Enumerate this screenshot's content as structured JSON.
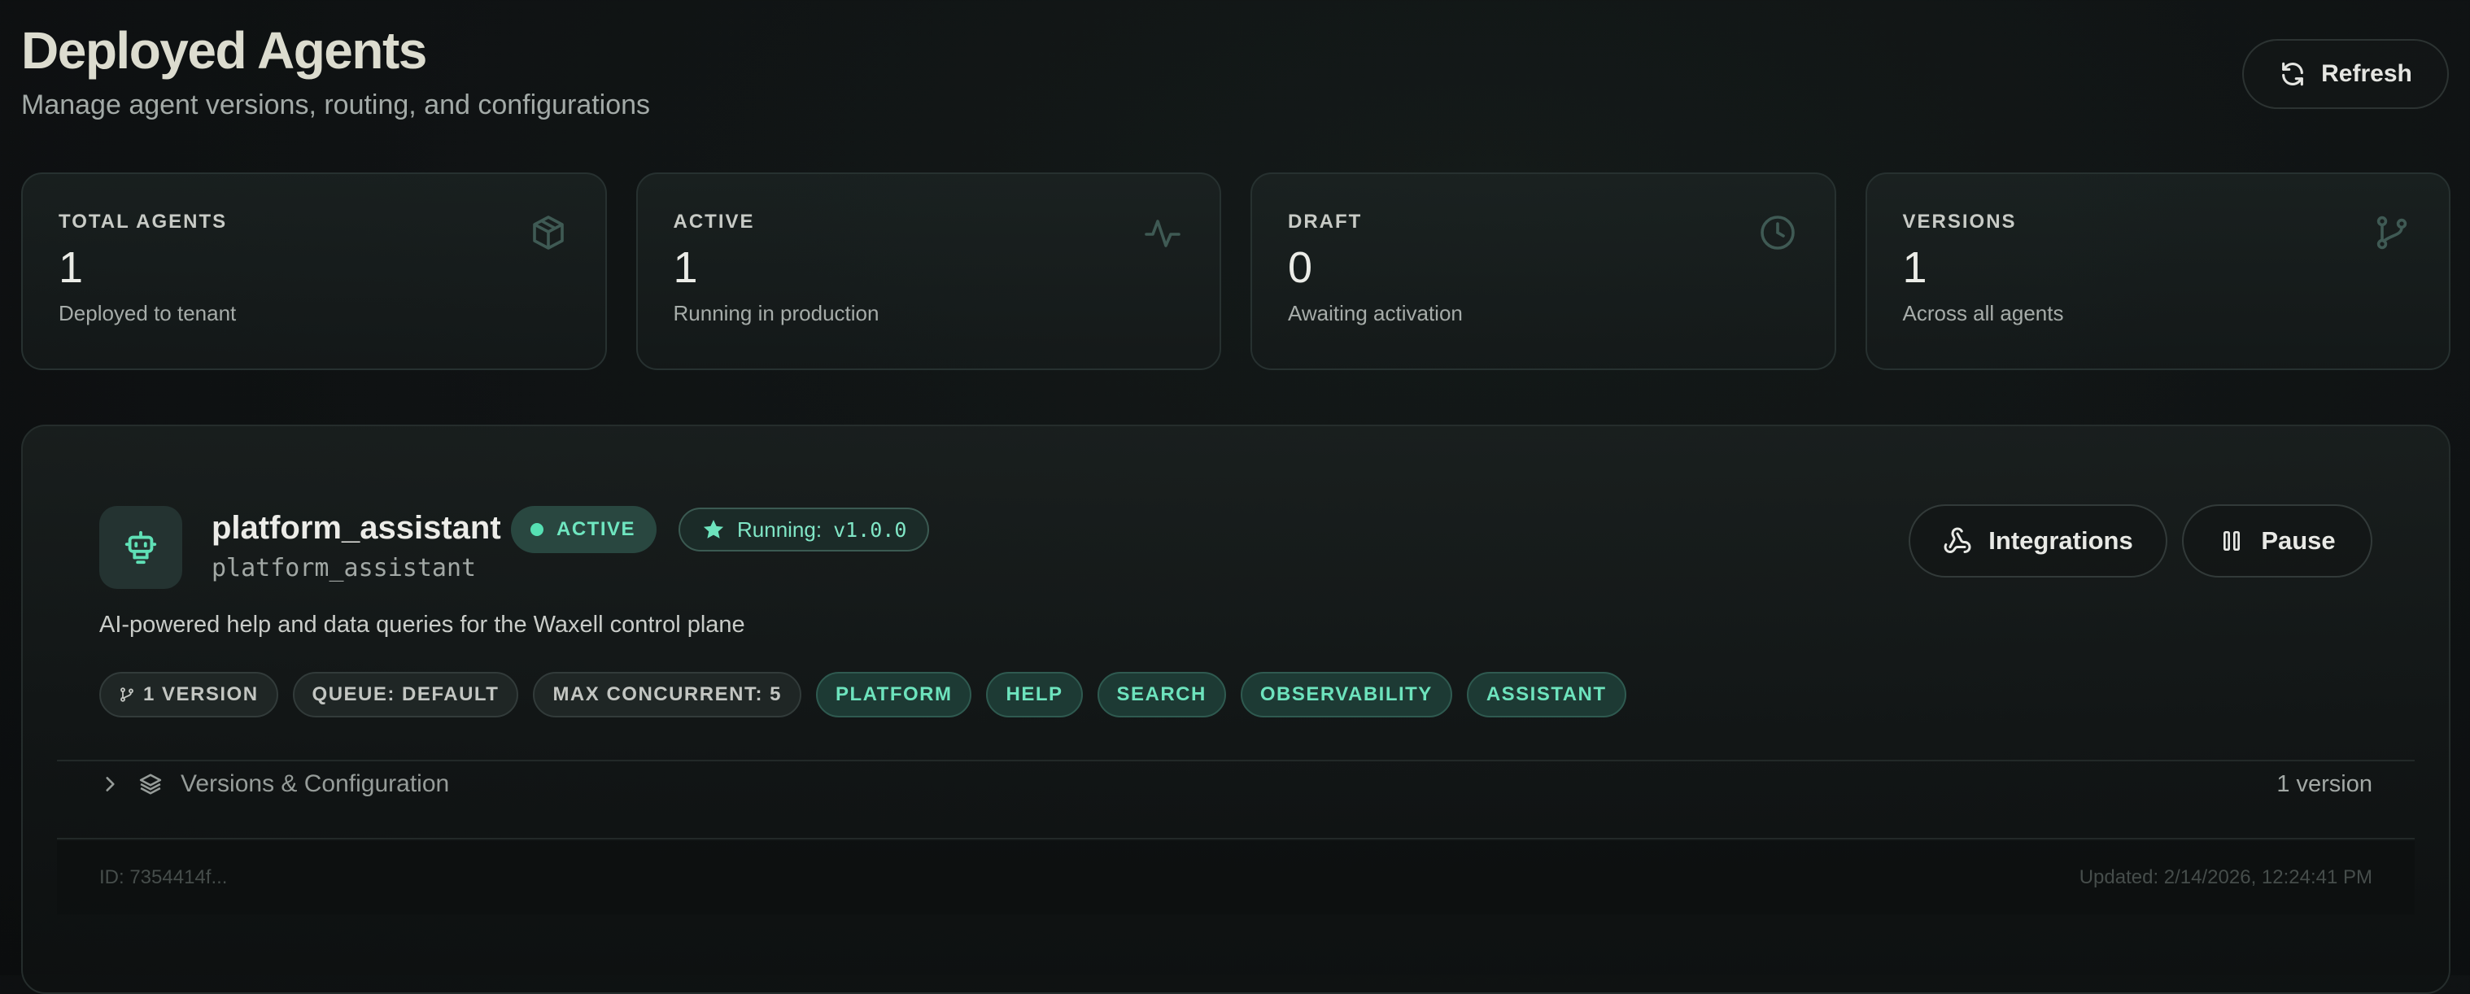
{
  "header": {
    "title": "Deployed Agents",
    "subtitle": "Manage agent versions, routing, and configurations",
    "refresh_label": "Refresh"
  },
  "stats": [
    {
      "label": "TOTAL AGENTS",
      "value": "1",
      "description": "Deployed to tenant",
      "icon": "box-icon"
    },
    {
      "label": "ACTIVE",
      "value": "1",
      "description": "Running in production",
      "icon": "activity-icon"
    },
    {
      "label": "DRAFT",
      "value": "0",
      "description": "Awaiting activation",
      "icon": "clock-icon"
    },
    {
      "label": "VERSIONS",
      "value": "1",
      "description": "Across all agents",
      "icon": "git-branch-icon"
    }
  ],
  "agent": {
    "name": "platform_assistant",
    "slug": "platform_assistant",
    "status": "ACTIVE",
    "running_label": "Running:",
    "running_version": "v1.0.0",
    "description": "AI-powered help and data queries for the Waxell control plane",
    "actions": {
      "integrations_label": "Integrations",
      "pause_label": "Pause"
    },
    "meta_tags": [
      "1 VERSION",
      "QUEUE: DEFAULT",
      "MAX CONCURRENT: 5"
    ],
    "topic_tags": [
      "PLATFORM",
      "HELP",
      "SEARCH",
      "OBSERVABILITY",
      "ASSISTANT"
    ],
    "versions_section": {
      "label": "Versions & Configuration",
      "count": "1 version"
    },
    "footer": {
      "id": "ID: 7354414f...",
      "updated": "Updated: 2/14/2026, 12:24:41 PM"
    }
  },
  "colors": {
    "accent": "#56e0b3",
    "background": "#0f1213",
    "card_border": "#273130"
  }
}
